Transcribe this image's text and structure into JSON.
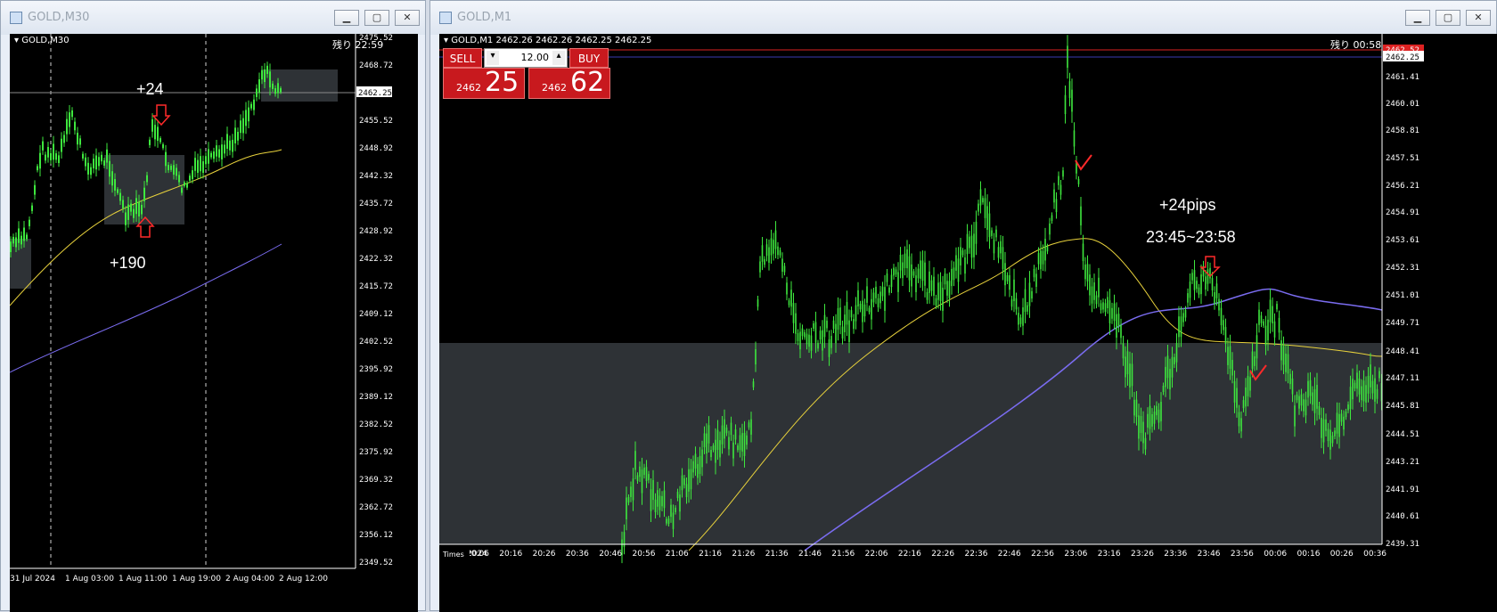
{
  "left_window": {
    "title": "GOLD,M30",
    "symbol_label": "GOLD,M30",
    "remaining": "残り 22:59",
    "current_price": "2462.25",
    "price_axis": [
      "2475.52",
      "2468.72",
      "2462.25",
      "2455.52",
      "2448.92",
      "2442.32",
      "2435.72",
      "2428.92",
      "2422.32",
      "2415.72",
      "2409.12",
      "2402.52",
      "2395.92",
      "2389.12",
      "2382.52",
      "2375.92",
      "2369.32",
      "2362.72",
      "2356.12",
      "2349.52"
    ],
    "time_axis": [
      "31 Jul 2024",
      "1 Aug 03:00",
      "1 Aug 11:00",
      "1 Aug 19:00",
      "2 Aug 04:00",
      "2 Aug 12:00"
    ],
    "annotations": {
      "top_text": "+24",
      "bottom_text": "+190"
    }
  },
  "right_window": {
    "title": "GOLD,M1",
    "symbol_label": "GOLD,M1  2462.26 2462.26 2462.25 2462.25",
    "remaining": "残り 00:58",
    "trade_panel": {
      "sell_label": "SELL",
      "buy_label": "BUY",
      "lot": "12.00",
      "sell_small": "2462",
      "sell_big": "25",
      "buy_small": "2462",
      "buy_big": "62",
      "down_arrow": "▾",
      "up_arrow": "▴"
    },
    "current_price": "2462.25",
    "top_price_label": "2462.52",
    "price_axis": [
      "2462.25",
      "2461.41",
      "2460.01",
      "2458.81",
      "2457.51",
      "2456.21",
      "2454.91",
      "2453.61",
      "2452.31",
      "2451.01",
      "2449.71",
      "2448.41",
      "2447.11",
      "2445.81",
      "2444.51",
      "2443.21",
      "2441.91",
      "2440.61",
      "2439.31"
    ],
    "time_axis": [
      "1 Aug 2024",
      "20:06",
      "20:16",
      "20:26",
      "20:36",
      "20:46",
      "20:56",
      "21:06",
      "21:16",
      "21:26",
      "21:36",
      "21:46",
      "21:56",
      "22:06",
      "22:16",
      "22:26",
      "22:36",
      "22:46",
      "22:56",
      "23:06",
      "23:16",
      "23:26",
      "23:36",
      "23:46",
      "23:56",
      "00:06",
      "00:16",
      "00:26",
      "00:36"
    ],
    "annotations": {
      "pips_text": "+24pips",
      "time_range": "23:45~23:58",
      "cursor_label": "Times"
    }
  },
  "icons": {
    "window": "window-icon",
    "min": "minimize-icon",
    "max": "maximize-icon",
    "close": "close-icon"
  },
  "colors": {
    "candle": "#3ee83e",
    "ma_fast": "#e8d23c",
    "ma_slow": "#7a6cf0",
    "annotation_arrow": "#ff2a2a",
    "box": "#2e3236"
  }
}
